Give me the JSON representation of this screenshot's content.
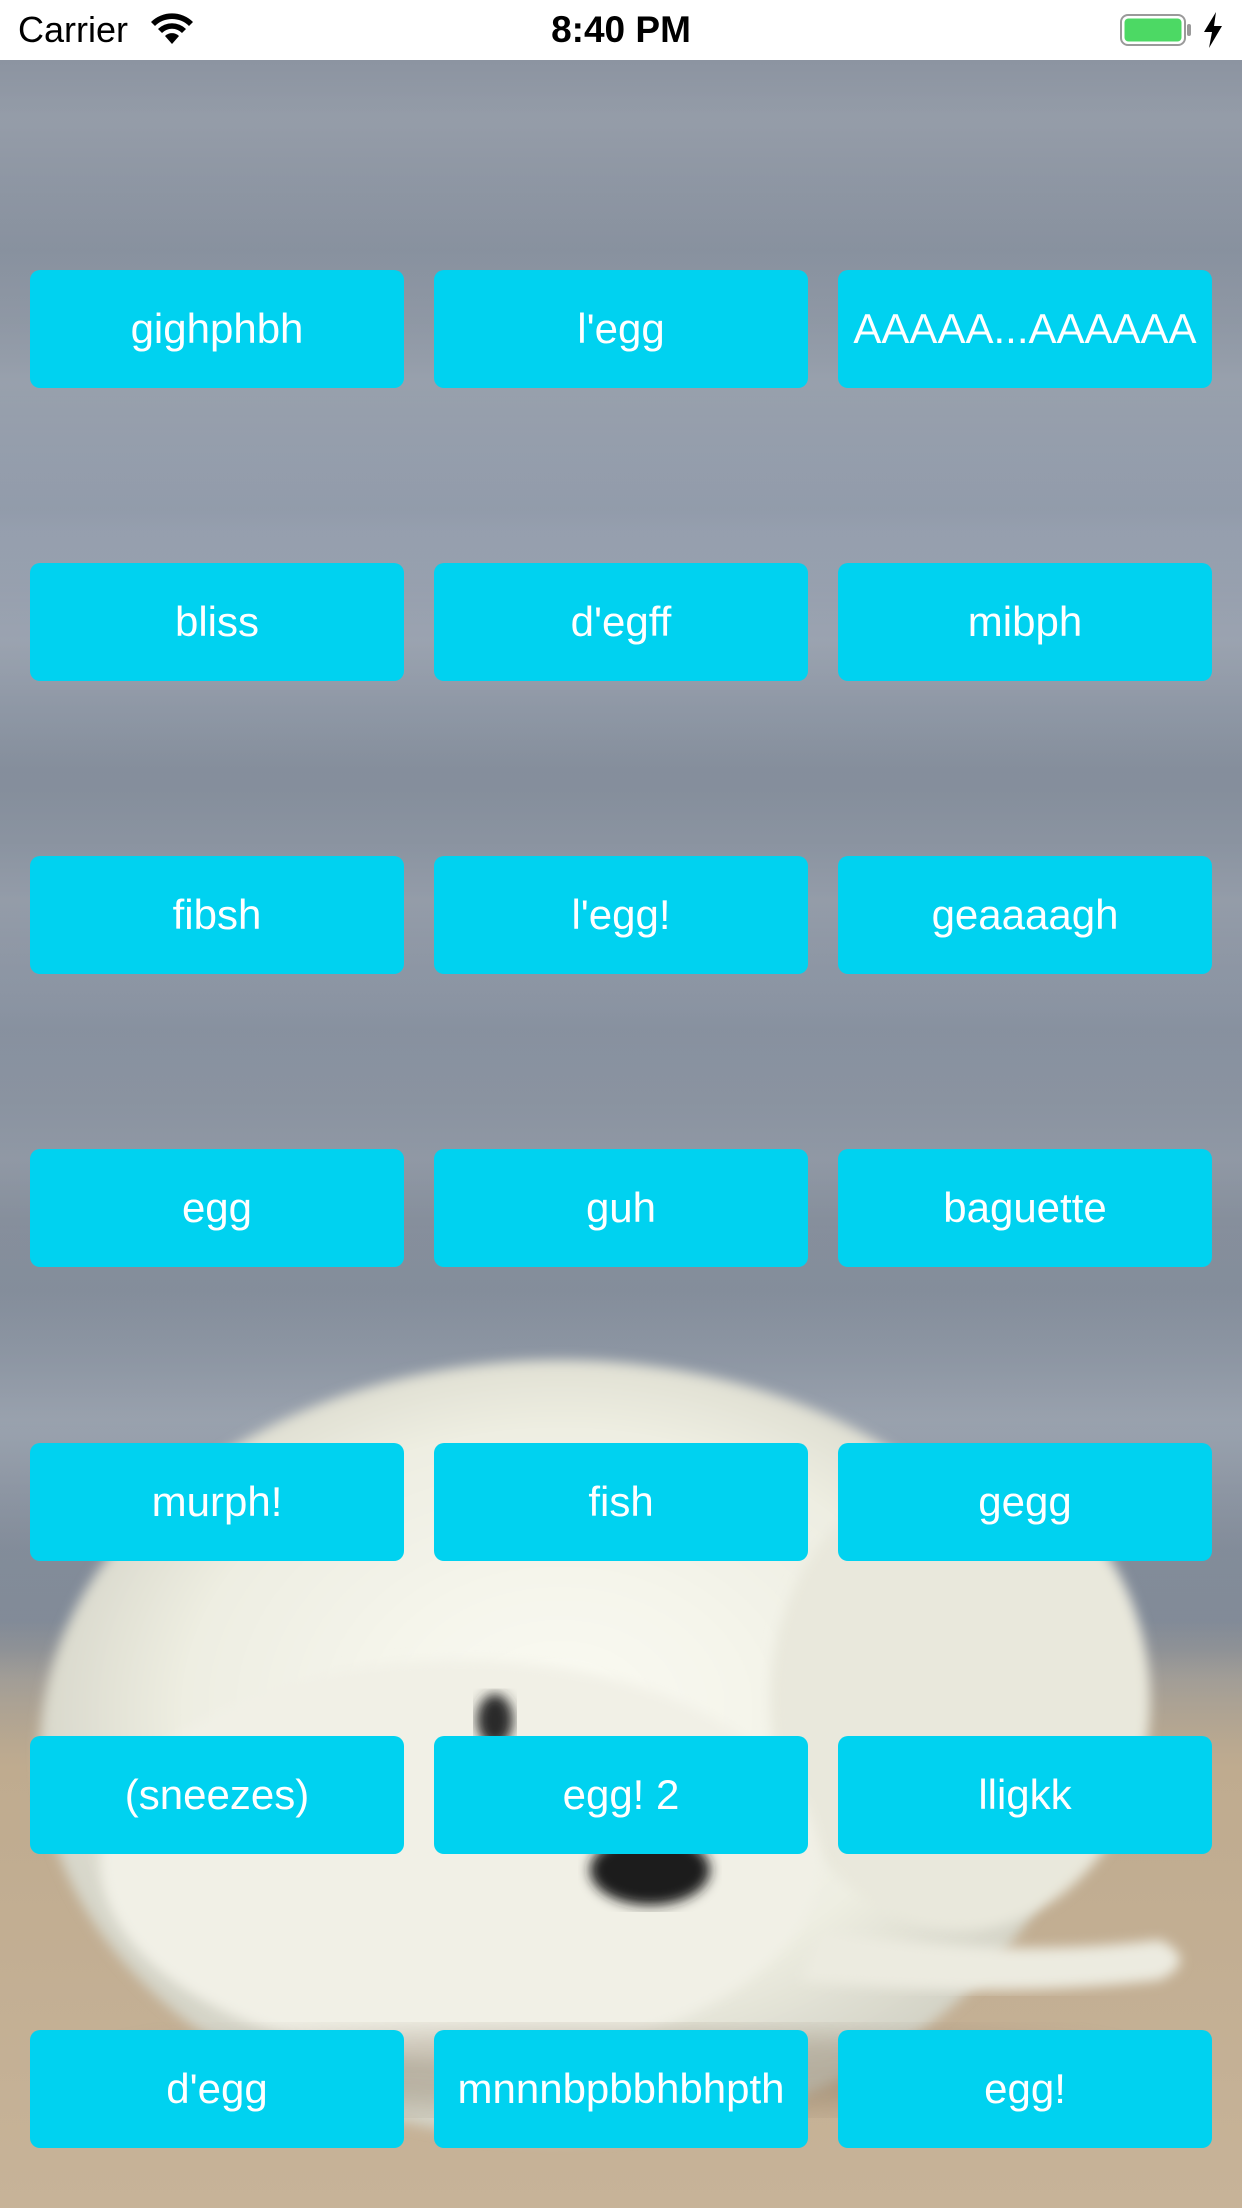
{
  "status_bar": {
    "carrier": "Carrier",
    "time": "8:40 PM",
    "wifi_icon": "wifi-icon",
    "battery_icon": "battery-icon",
    "charging_icon": "charging-bolt-icon",
    "battery_color": "#4cd964"
  },
  "background": {
    "subject": "seal-pup-photo"
  },
  "theme": {
    "button_color": "#00d2f0",
    "button_text_color": "#ffffff"
  },
  "buttons": [
    {
      "label": "gighphbh"
    },
    {
      "label": "l'egg"
    },
    {
      "label": "AAAAA...AAAAAA"
    },
    {
      "label": "bliss"
    },
    {
      "label": "d'egff"
    },
    {
      "label": "mibph"
    },
    {
      "label": "fibsh"
    },
    {
      "label": "l'egg!"
    },
    {
      "label": "geaaaagh"
    },
    {
      "label": "egg"
    },
    {
      "label": "guh"
    },
    {
      "label": "baguette"
    },
    {
      "label": "murph!"
    },
    {
      "label": "fish"
    },
    {
      "label": "gegg"
    },
    {
      "label": "(sneezes)"
    },
    {
      "label": "egg! 2"
    },
    {
      "label": "lligkk"
    },
    {
      "label": "d'egg"
    },
    {
      "label": "mnnnbpbbhbhpth"
    },
    {
      "label": "egg!"
    }
  ]
}
